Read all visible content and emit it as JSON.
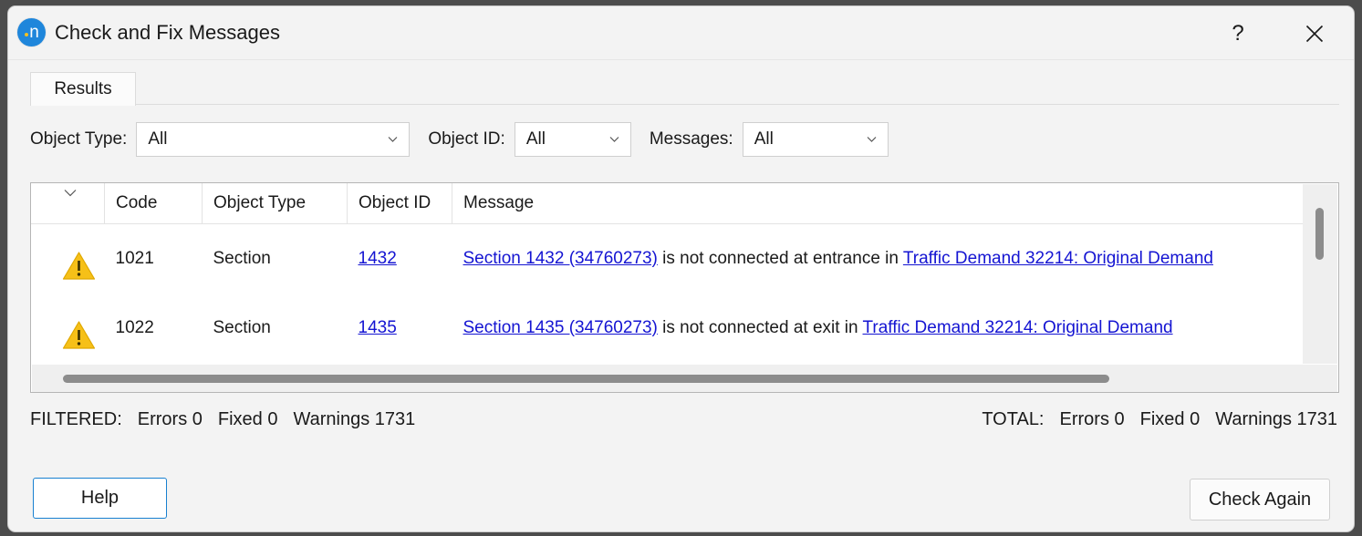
{
  "window": {
    "title": "Check and Fix Messages",
    "app_icon": "aimsun-next-icon",
    "help_button": "?",
    "close_button": "close-icon"
  },
  "tabs": [
    {
      "label": "Results",
      "active": true
    }
  ],
  "filters": [
    {
      "label": "Object Type:",
      "value": "All",
      "name": "object-type"
    },
    {
      "label": "Object ID:",
      "value": "All",
      "name": "object-id"
    },
    {
      "label": "Messages:",
      "value": "All",
      "name": "messages"
    }
  ],
  "table": {
    "columns": [
      "",
      "Code",
      "Object Type",
      "Object ID",
      "Message"
    ],
    "sort_indicator": "chevron-down-icon",
    "rows": [
      {
        "severity": "warning",
        "code": "1021",
        "object_type": "Section",
        "object_id": "1432",
        "message_link_1": "Section 1432 (34760273)",
        "message_mid": " is not connected at entrance in ",
        "message_link_2": "Traffic Demand 32214: Original Demand"
      },
      {
        "severity": "warning",
        "code": "1022",
        "object_type": "Section",
        "object_id": "1435",
        "message_link_1": "Section 1435 (34760273)",
        "message_mid": " is not connected at exit in ",
        "message_link_2": "Traffic Demand 32214: Original Demand"
      }
    ]
  },
  "status": {
    "filtered_label": "FILTERED:",
    "filtered_errors": "Errors 0",
    "filtered_fixed": "Fixed 0",
    "filtered_warnings": "Warnings 1731",
    "total_label": "TOTAL:",
    "total_errors": "Errors 0",
    "total_fixed": "Fixed 0",
    "total_warnings": "Warnings 1731"
  },
  "footer": {
    "help_label": "Help",
    "check_again_label": "Check Again"
  },
  "colors": {
    "link": "#1414d2",
    "warning": "#f6c018",
    "accent": "#1880d0",
    "window_bg": "#f3f3f3"
  }
}
